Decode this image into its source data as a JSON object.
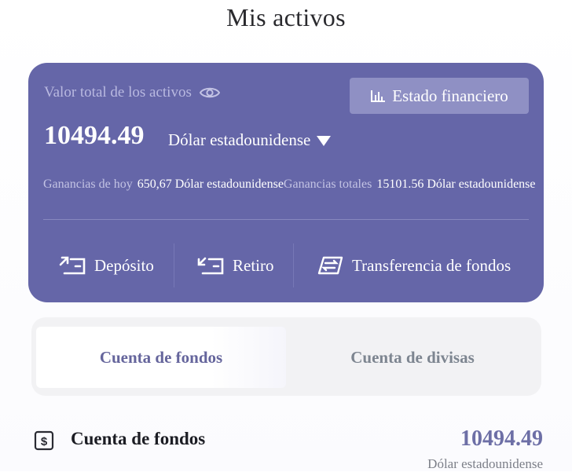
{
  "page": {
    "title": "Mis activos"
  },
  "summary": {
    "total_label": "Valor total de los activos",
    "statement_button": "Estado financiero",
    "amount": "10494.49",
    "currency": "Dólar estadounidense",
    "today_earnings_label": "Ganancias de hoy",
    "today_earnings_value": "650,67 Dólar estadounidense",
    "total_earnings_label": "Ganancias totales",
    "total_earnings_value": "15101.56 Dólar estadounidense"
  },
  "actions": {
    "deposit": "Depósito",
    "withdraw": "Retiro",
    "transfer": "Transferencia de fondos"
  },
  "tabs": [
    {
      "label": "Cuenta de fondos",
      "active": true
    },
    {
      "label": "Cuenta de divisas",
      "active": false
    }
  ],
  "account": {
    "title": "Cuenta de fondos",
    "amount": "10494.49",
    "currency": "Dólar estadounidense",
    "icon": "dollar-doc-icon"
  },
  "colors": {
    "card": "#6566a8",
    "accent": "#65659c"
  }
}
